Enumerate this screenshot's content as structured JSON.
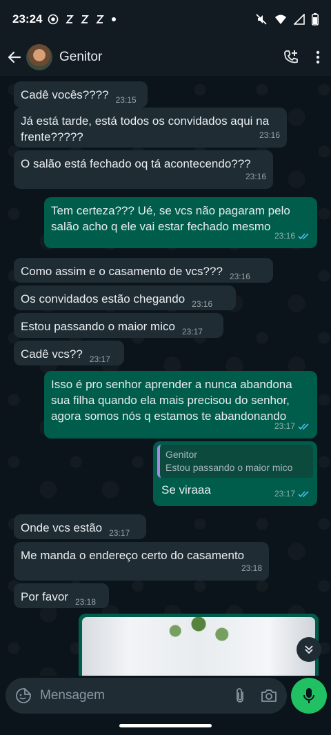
{
  "status_bar": {
    "time": "23:24",
    "icons": [
      "camera-record-icon",
      "app-notification-icon",
      "app-notification-icon",
      "app-notification-icon",
      "dot-icon"
    ],
    "right_icons": [
      "mute-icon",
      "wifi-icon",
      "signal-icon",
      "battery-icon"
    ]
  },
  "header": {
    "contact_name": "Genitor",
    "icons": [
      "back-arrow-icon",
      "add-call-icon",
      "more-vert-icon"
    ]
  },
  "messages": [
    {
      "dir": "in",
      "text": "Cadê vocês????",
      "time": "23:15"
    },
    {
      "dir": "in",
      "text": "Já está tarde, está todos os convidados aqui na frente?????",
      "time": "23:16"
    },
    {
      "dir": "in",
      "text": "O salão está fechado oq tá acontecendo???",
      "time": "23:16"
    },
    {
      "dir": "out",
      "text": "Tem certeza??? Ué, se vcs não pagaram pelo salão acho q ele vai estar fechado mesmo",
      "time": "23:16",
      "status": "read"
    },
    {
      "dir": "in",
      "text": "Como assim e o casamento de vcs???",
      "time": "23:16"
    },
    {
      "dir": "in",
      "text": "Os convidados estão chegando",
      "time": "23:16"
    },
    {
      "dir": "in",
      "text": "Estou passando o maior mico",
      "time": "23:17"
    },
    {
      "dir": "in",
      "text": "Cadê vcs??",
      "time": "23:17"
    },
    {
      "dir": "out",
      "text": "Isso é pro senhor aprender a nunca abandona sua filha quando ela mais precisou do senhor, agora somos nós q estamos te abandonando",
      "time": "23:17",
      "status": "read"
    },
    {
      "dir": "out",
      "quote_name": "Genitor",
      "quote_text": "Estou passando o maior mico",
      "text": "Se viraaa",
      "time": "23:17",
      "status": "read"
    },
    {
      "dir": "in",
      "text": "Onde vcs estão",
      "time": "23:17"
    },
    {
      "dir": "in",
      "text": "Me manda o endereço certo do casamento",
      "time": "23:18"
    },
    {
      "dir": "in",
      "text": "Por favor",
      "time": "23:18"
    }
  ],
  "composer": {
    "placeholder": "Mensagem",
    "icons": [
      "sticker-icon",
      "attach-icon",
      "camera-icon",
      "mic-icon"
    ]
  },
  "colors": {
    "incoming_bubble": "#1f2c34",
    "outgoing_bubble": "#005c4b",
    "read_ticks": "#53bdeb",
    "mic_button": "#21c063"
  }
}
